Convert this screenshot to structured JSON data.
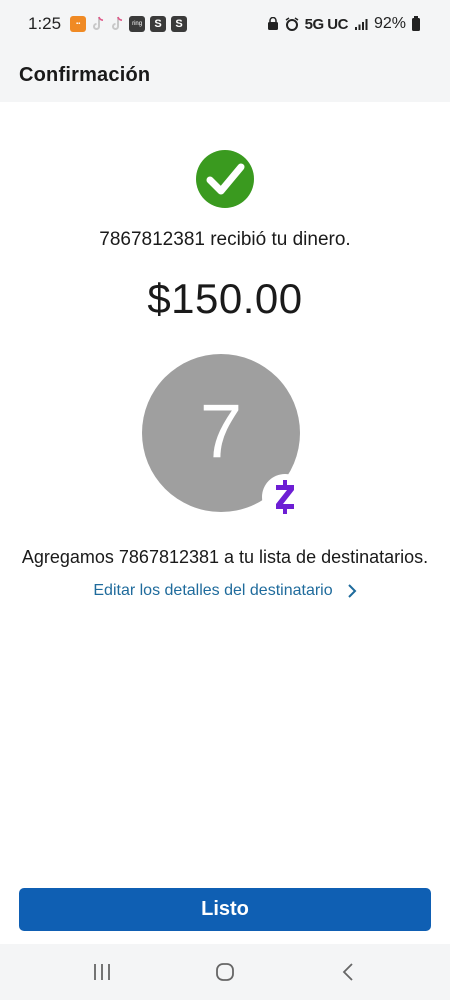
{
  "status_bar": {
    "time": "1:25",
    "notif_ring": "ring",
    "notif_s1": "S",
    "notif_s2": "S",
    "network": "5G UC",
    "battery": "92%"
  },
  "header": {
    "title": "Confirmación"
  },
  "confirmation": {
    "received_message": "7867812381 recibió tu dinero.",
    "amount": "$150.00",
    "avatar_initial": "7",
    "added_message": "Agregamos 7867812381 a tu lista de destinatarios.",
    "edit_link_label": "Editar los detalles del destinatario"
  },
  "footer": {
    "done_label": "Listo"
  },
  "colors": {
    "check_green": "#3a9a1f",
    "primary_blue": "#0f5fb3",
    "link_blue": "#1f6b9c",
    "zelle_purple": "#6d1ed4",
    "avatar_gray": "#9f9f9f"
  },
  "icons": {
    "check": "check-circle-icon",
    "zelle": "zelle-logo-icon",
    "chevron": "chevron-right-icon",
    "nav_recents": "recents-icon",
    "nav_home": "home-icon",
    "nav_back": "back-icon"
  }
}
